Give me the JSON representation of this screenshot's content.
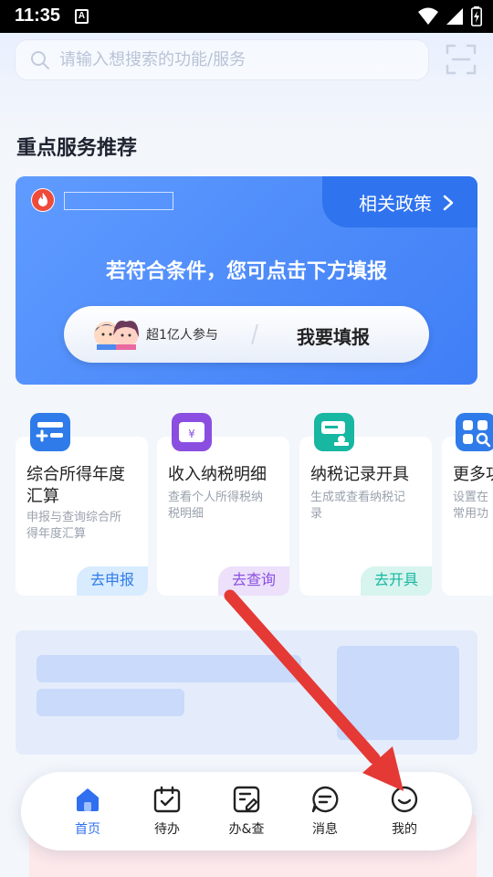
{
  "status_bar": {
    "time": "11:35",
    "notif": "A"
  },
  "search": {
    "placeholder": "请输入想搜索的功能/服务"
  },
  "section": {
    "title": "重点服务推荐"
  },
  "promo": {
    "policy_link": "相关政策",
    "headline": "若符合条件，您可点击下方填报",
    "participants": "超1亿人参与",
    "cta": "我要填报"
  },
  "services": [
    {
      "title1": "综合所得年度",
      "title2": "汇算",
      "desc1": "申报与查询综合所",
      "desc2": "得年度汇算",
      "action": "去申报",
      "color": "#2f7be9"
    },
    {
      "title1": "收入纳税明细",
      "title2": "",
      "desc1": "查看个人所得税纳",
      "desc2": "税明细",
      "action": "去查询",
      "color": "#8a4fe0"
    },
    {
      "title1": "纳税记录开具",
      "title2": "",
      "desc1": "生成或查看纳税记",
      "desc2": "录",
      "action": "去开具",
      "color": "#17b7a2"
    },
    {
      "title1": "更多功",
      "title2": "",
      "desc1": "设置在",
      "desc2": "常用功",
      "action": "",
      "color": "#2f7be9"
    }
  ],
  "nav": [
    {
      "label": "首页",
      "icon": "home-icon",
      "active": true
    },
    {
      "label": "待办",
      "icon": "calendar-check-icon",
      "active": false
    },
    {
      "label": "办&查",
      "icon": "edit-doc-icon",
      "active": false
    },
    {
      "label": "消息",
      "icon": "message-icon",
      "active": false
    },
    {
      "label": "我的",
      "icon": "smile-face-icon",
      "active": false
    }
  ],
  "colors": {
    "brand": "#3f7ef6",
    "arrow": "#e53935"
  }
}
